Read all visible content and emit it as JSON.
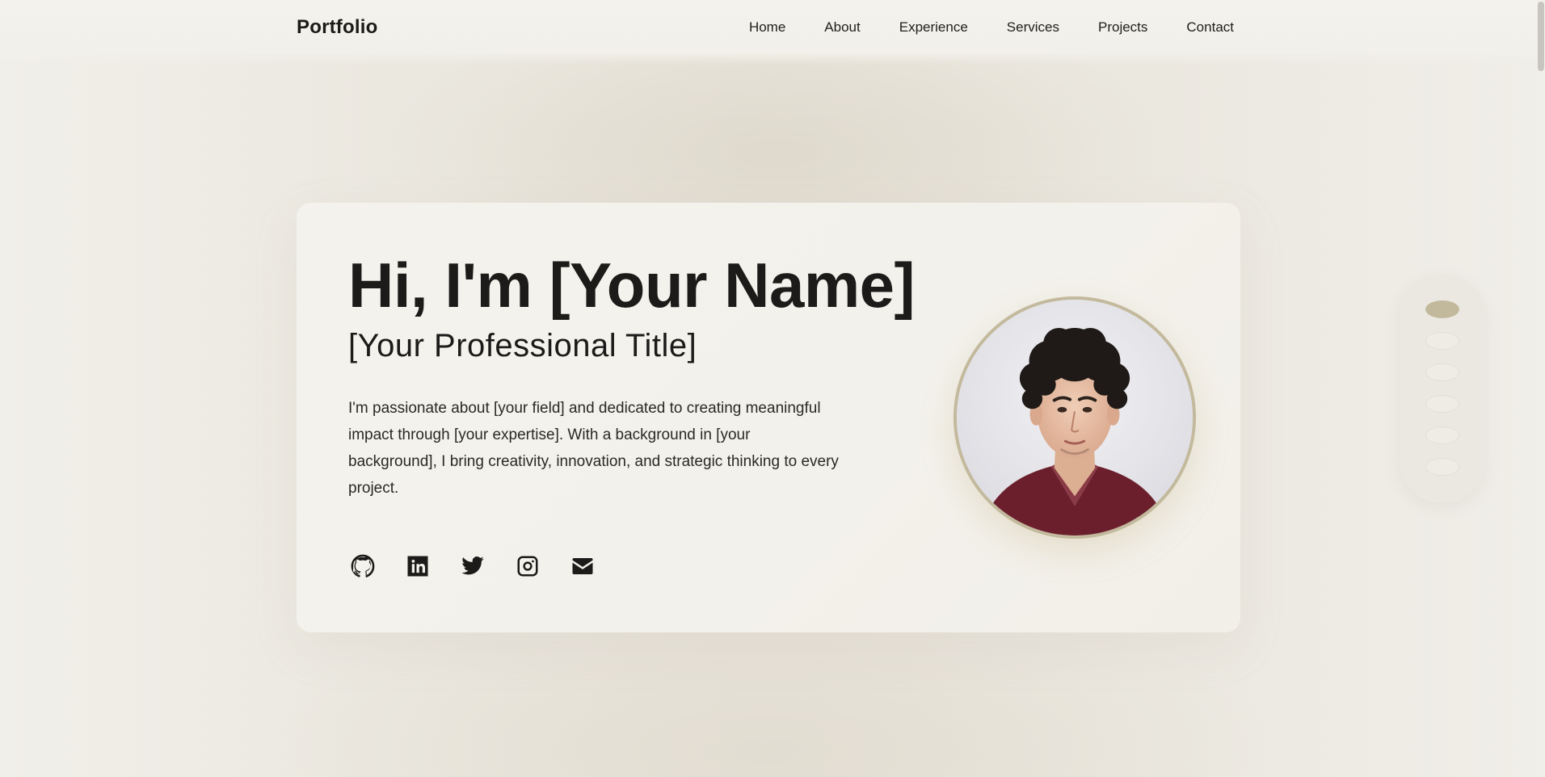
{
  "brand": "Portfolio",
  "nav": [
    {
      "label": "Home"
    },
    {
      "label": "About"
    },
    {
      "label": "Experience"
    },
    {
      "label": "Services"
    },
    {
      "label": "Projects"
    },
    {
      "label": "Contact"
    }
  ],
  "hero": {
    "name": "Hi, I'm [Your Name]",
    "title": "[Your Professional Title]",
    "bio": "I'm passionate about [your field] and dedicated to creating meaningful impact through [your expertise]. With a background in [your background], I bring creativity, innovation, and strategic thinking to every project."
  },
  "socials": [
    {
      "icon": "github-icon"
    },
    {
      "icon": "linkedin-icon"
    },
    {
      "icon": "twitter-icon"
    },
    {
      "icon": "instagram-icon"
    },
    {
      "icon": "email-icon"
    }
  ],
  "side_nav": {
    "dots": 6,
    "active_index": 0
  },
  "colors": {
    "accent": "#c2b99d",
    "background": "#ebe8e0",
    "card": "#f3f1eb",
    "text": "#1c1b19"
  }
}
